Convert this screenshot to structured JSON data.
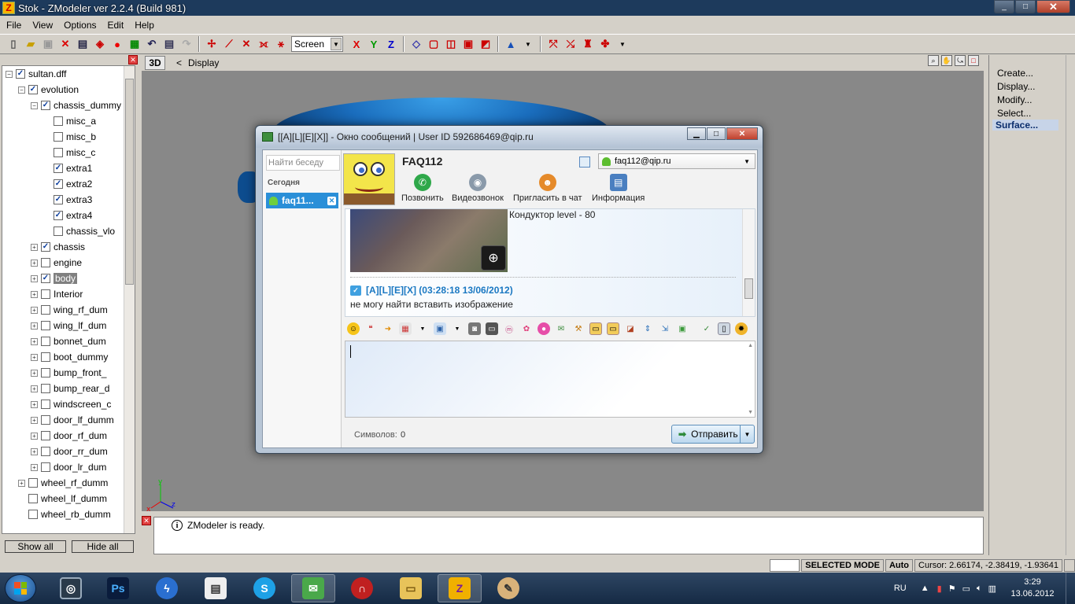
{
  "app": {
    "title": "Stok - ZModeler ver 2.2.4 (Build 981)",
    "icon": "Z",
    "window_buttons": [
      "minimize",
      "maximize",
      "close"
    ]
  },
  "menu": [
    "File",
    "View",
    "Options",
    "Edit",
    "Help"
  ],
  "toolbar": {
    "view_select": "Screen",
    "axis_x": "X",
    "axis_y": "Y",
    "axis_z": "Z"
  },
  "tree": {
    "items": [
      {
        "label": "sultan.dff",
        "checked": true,
        "expander": "-"
      },
      {
        "label": "evolution",
        "checked": true,
        "expander": "-"
      },
      {
        "label": "chassis_dummy",
        "checked": true,
        "expander": "-"
      },
      {
        "label": "misc_a",
        "checked": false,
        "expander": ""
      },
      {
        "label": "misc_b",
        "checked": false,
        "expander": ""
      },
      {
        "label": "misc_c",
        "checked": false,
        "expander": ""
      },
      {
        "label": "extra1",
        "checked": true,
        "expander": ""
      },
      {
        "label": "extra2",
        "checked": true,
        "expander": ""
      },
      {
        "label": "extra3",
        "checked": true,
        "expander": ""
      },
      {
        "label": "extra4",
        "checked": true,
        "expander": ""
      },
      {
        "label": "chassis_vlo",
        "checked": false,
        "expander": ""
      },
      {
        "label": "chassis",
        "checked": true,
        "expander": "+"
      },
      {
        "label": "engine",
        "checked": false,
        "expander": "+"
      },
      {
        "label": "body",
        "checked": true,
        "expander": "+",
        "selected": true
      },
      {
        "label": "Interior",
        "checked": false,
        "expander": "+"
      },
      {
        "label": "wing_rf_dum",
        "checked": false,
        "expander": "+"
      },
      {
        "label": "wing_lf_dum",
        "checked": false,
        "expander": "+"
      },
      {
        "label": "bonnet_dum",
        "checked": false,
        "expander": "+"
      },
      {
        "label": "boot_dummy",
        "checked": false,
        "expander": "+"
      },
      {
        "label": "bump_front_",
        "checked": false,
        "expander": "+"
      },
      {
        "label": "bump_rear_d",
        "checked": false,
        "expander": "+"
      },
      {
        "label": "windscreen_c",
        "checked": false,
        "expander": "+"
      },
      {
        "label": "door_lf_dumm",
        "checked": false,
        "expander": "+"
      },
      {
        "label": "door_rf_dum",
        "checked": false,
        "expander": "+"
      },
      {
        "label": "door_rr_dum",
        "checked": false,
        "expander": "+"
      },
      {
        "label": "door_lr_dum",
        "checked": false,
        "expander": "+"
      },
      {
        "label": "wheel_rf_dumm",
        "checked": false,
        "expander": "+"
      },
      {
        "label": "wheel_lf_dumm",
        "checked": false,
        "expander": ""
      },
      {
        "label": "wheel_rb_dumm",
        "checked": false,
        "expander": ""
      }
    ],
    "show_all": "Show all",
    "hide_all": "Hide all"
  },
  "viewport": {
    "mode": "3D",
    "back": "<",
    "name": "Display"
  },
  "command_panel": [
    "Create...",
    "Display...",
    "Modify...",
    "Select...",
    "Surface..."
  ],
  "log": {
    "message": "ZModeler is ready."
  },
  "statusbar": {
    "mode": "SELECTED MODE",
    "auto": "Auto",
    "cursor": "Cursor: 2.66174, -2.38419, -1.93641"
  },
  "chat": {
    "title": "[[A][L][E][X]] - Окно сообщений | User ID 592686469@qip.ru",
    "search_placeholder": "Найти беседу",
    "group": "Сегодня",
    "contact": "faq11...",
    "name": "FAQ112",
    "account": "faq112@qip.ru",
    "actions": [
      "Позвонить",
      "Видеозвонок",
      "Пригласить в чат",
      "Информация"
    ],
    "quote": "Кондуктор level - 80",
    "msg_header": "[A][L][E][X] (03:28:18 13/06/2012)",
    "msg_text": "не могу найти вставить изображение",
    "counter_label": "Символов:",
    "counter": "0",
    "send": "Отправить"
  },
  "taskbar": {
    "lang": "RU",
    "time": "3:29",
    "date": "13.06.2012",
    "ps_label": "Ps",
    "zm_label": "Z"
  }
}
